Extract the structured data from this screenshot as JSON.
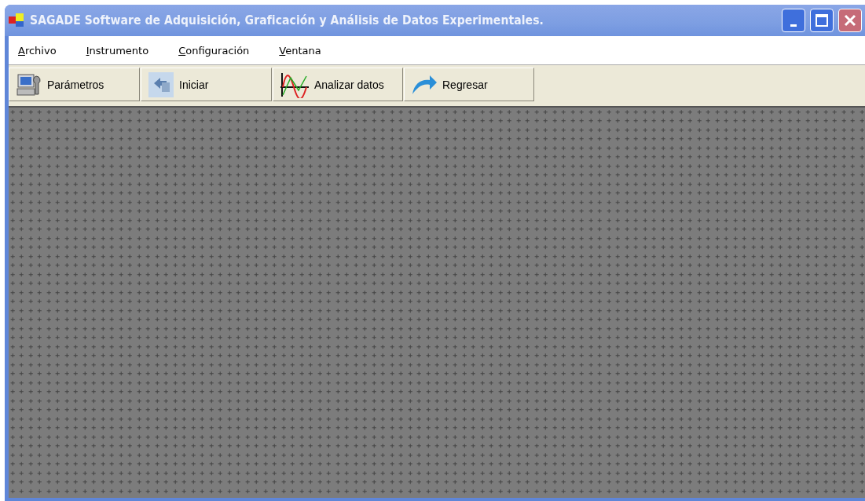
{
  "window": {
    "title": "SAGADE Software de Adquisición, Graficación y Análisis de Datos Experimentales."
  },
  "menu": [
    "Archivo",
    "Instrumento",
    "Configuración",
    "Ventana"
  ],
  "toolbar": [
    {
      "label": "Parámetros",
      "kind": "params"
    },
    {
      "label": "Iniciar",
      "kind": "start"
    },
    {
      "label": "Analizar datos",
      "kind": "analyze"
    },
    {
      "label": "Regresar",
      "kind": "back"
    }
  ]
}
